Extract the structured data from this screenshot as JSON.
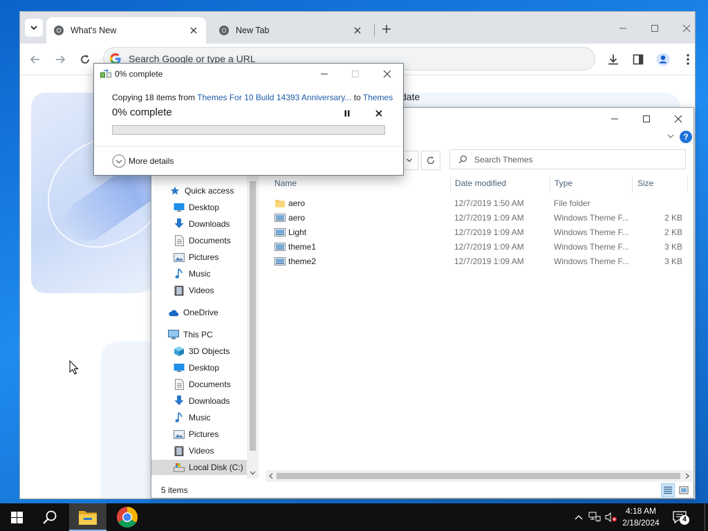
{
  "chrome": {
    "tabs": [
      {
        "title": "What's New",
        "active": true
      },
      {
        "title": "New Tab",
        "active": false
      }
    ],
    "omnibox": {
      "placeholder": "Search Google or type a URL",
      "value": ""
    },
    "content": {
      "partial_heading": "date"
    }
  },
  "explorer": {
    "search": {
      "placeholder": "Search Themes"
    },
    "columns": [
      "Name",
      "Date modified",
      "Type",
      "Size"
    ],
    "nav": [
      {
        "label": "Quick access",
        "icon": "star-icon",
        "level": 0,
        "pinned": false
      },
      {
        "label": "Desktop",
        "icon": "desktop-icon",
        "level": 1,
        "pinned": true
      },
      {
        "label": "Downloads",
        "icon": "download-icon",
        "level": 1,
        "pinned": true
      },
      {
        "label": "Documents",
        "icon": "documents-icon",
        "level": 1,
        "pinned": true
      },
      {
        "label": "Pictures",
        "icon": "pictures-icon",
        "level": 1,
        "pinned": true
      },
      {
        "label": "Music",
        "icon": "music-icon",
        "level": 1,
        "pinned": false
      },
      {
        "label": "Videos",
        "icon": "videos-icon",
        "level": 1,
        "pinned": false
      },
      {
        "label": "OneDrive",
        "icon": "cloud-icon",
        "level": 0,
        "pinned": false
      },
      {
        "label": "This PC",
        "icon": "computer-icon",
        "level": 0,
        "pinned": false
      },
      {
        "label": "3D Objects",
        "icon": "cube-icon",
        "level": 1,
        "pinned": false
      },
      {
        "label": "Desktop",
        "icon": "desktop-icon",
        "level": 1,
        "pinned": false
      },
      {
        "label": "Documents",
        "icon": "documents-icon",
        "level": 1,
        "pinned": false
      },
      {
        "label": "Downloads",
        "icon": "download-icon",
        "level": 1,
        "pinned": false
      },
      {
        "label": "Music",
        "icon": "music-icon",
        "level": 1,
        "pinned": false
      },
      {
        "label": "Pictures",
        "icon": "pictures-icon",
        "level": 1,
        "pinned": false
      },
      {
        "label": "Videos",
        "icon": "videos-icon",
        "level": 1,
        "pinned": false
      },
      {
        "label": "Local Disk (C:)",
        "icon": "drive-icon",
        "level": 1,
        "pinned": false,
        "selected": true
      }
    ],
    "files": [
      {
        "name": "aero",
        "date": "12/7/2019 1:50 AM",
        "type": "File folder",
        "size": "",
        "icon": "folder-icon"
      },
      {
        "name": "aero",
        "date": "12/7/2019 1:09 AM",
        "type": "Windows Theme F...",
        "size": "2 KB",
        "icon": "theme-file-icon"
      },
      {
        "name": "Light",
        "date": "12/7/2019 1:09 AM",
        "type": "Windows Theme F...",
        "size": "2 KB",
        "icon": "theme-file-icon"
      },
      {
        "name": "theme1",
        "date": "12/7/2019 1:09 AM",
        "type": "Windows Theme F...",
        "size": "3 KB",
        "icon": "theme-file-icon"
      },
      {
        "name": "theme2",
        "date": "12/7/2019 1:09 AM",
        "type": "Windows Theme F...",
        "size": "3 KB",
        "icon": "theme-file-icon"
      }
    ],
    "status": {
      "item_count": "5 items"
    }
  },
  "copy_dialog": {
    "title": "0% complete",
    "copying_prefix": "Copying 18 items from ",
    "source": "Themes For 10 Build 14393 Anniversary...",
    "to_word": " to ",
    "destination": "Themes",
    "percent_text": "0% complete",
    "progress_fraction": 0,
    "more_details": "More details"
  },
  "taskbar": {
    "time": "4:18 AM",
    "date": "2/18/2024",
    "notification_count": "4",
    "apps": [
      "file-explorer-icon",
      "chrome-icon"
    ]
  },
  "colors": {
    "desktop": "#1f8bf0",
    "chrome_tabstrip": "#dfe3e8",
    "progress_green": "#06b025",
    "link_blue": "#1e5aa8",
    "taskbar": "#101010"
  }
}
